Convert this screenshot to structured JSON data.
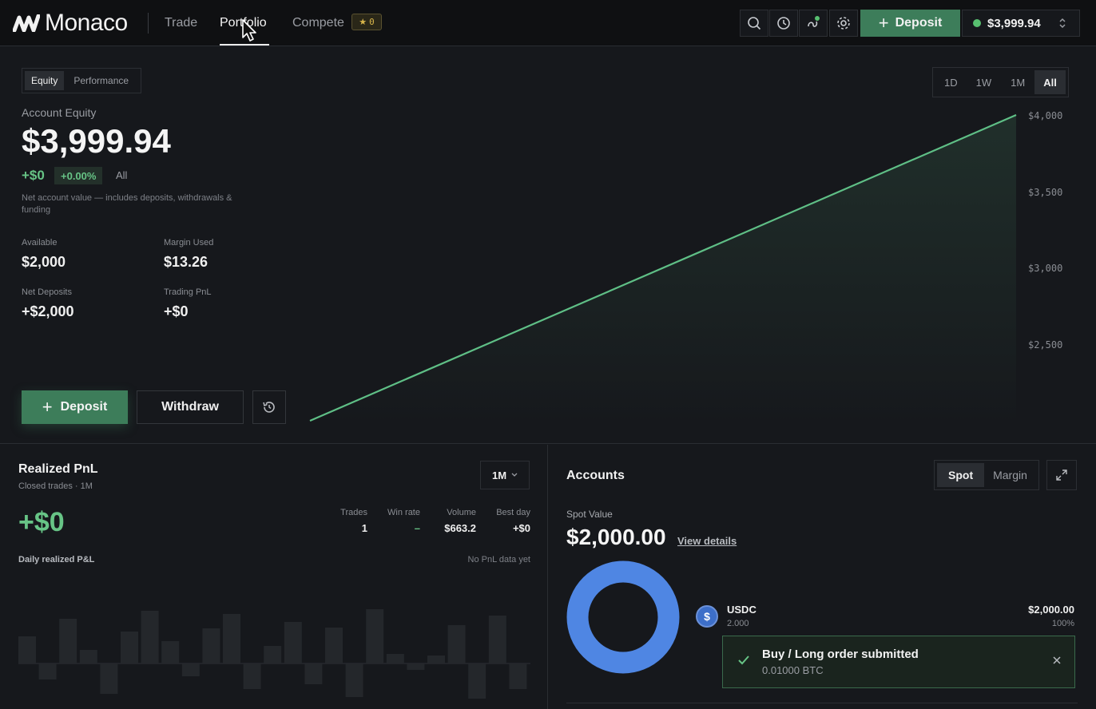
{
  "nav": {
    "brand": "Monaco",
    "links": [
      "Trade",
      "Portfolio",
      "Compete"
    ],
    "compete_badge": "0",
    "deposit_label": "Deposit",
    "balance": "$3,999.94"
  },
  "equity": {
    "tabs": [
      "Equity",
      "Performance"
    ],
    "ranges": [
      "1D",
      "1W",
      "1M",
      "All"
    ],
    "title": "Account Equity",
    "value": "$3,999.94",
    "change": "+$0",
    "change_pct": "+0.00%",
    "range_label": "All",
    "note": "Net account value — includes deposits, withdrawals & funding",
    "stats": [
      {
        "label": "Available",
        "value": "$2,000"
      },
      {
        "label": "Margin Used",
        "value": "$13.26"
      },
      {
        "label": "Net Deposits",
        "value": "+$2,000"
      },
      {
        "label": "Trading PnL",
        "value": "+$0"
      }
    ],
    "deposit_label": "Deposit",
    "withdraw_label": "Withdraw",
    "y_ticks": [
      "$4,000",
      "$3,500",
      "$3,000",
      "$2,500"
    ],
    "colors": {
      "line": "#5fbf86",
      "accent": "#3d7d5a"
    }
  },
  "chart_data": {
    "type": "area",
    "x": [
      0,
      1
    ],
    "values": [
      2000,
      3999.94
    ],
    "ylim": [
      2000,
      4000
    ],
    "title": "",
    "xlabel": "",
    "ylabel": ""
  },
  "pnl": {
    "title": "Realized PnL",
    "subtitle": "Closed trades · 1M",
    "range": "1M",
    "value": "+$0",
    "metrics": [
      {
        "label": "Trades",
        "value": "1"
      },
      {
        "label": "Win rate",
        "value": "–"
      },
      {
        "label": "Volume",
        "value": "$663.2"
      },
      {
        "label": "Best day",
        "value": "+$0"
      }
    ],
    "daily_label": "Daily realized P&L",
    "empty_label": "No PnL data yet"
  },
  "accounts": {
    "title": "Accounts",
    "tabs": [
      "Spot",
      "Margin"
    ],
    "spot_label": "Spot Value",
    "spot_value": "$2,000.00",
    "view_details": "View details",
    "asset": {
      "symbol": "USDC",
      "amount": "2.000",
      "value": "$2,000.00",
      "share": "100%"
    },
    "donut_color": "#4f86e3"
  },
  "toast": {
    "title": "Buy / Long order submitted",
    "subtitle": "0.01000 BTC"
  }
}
